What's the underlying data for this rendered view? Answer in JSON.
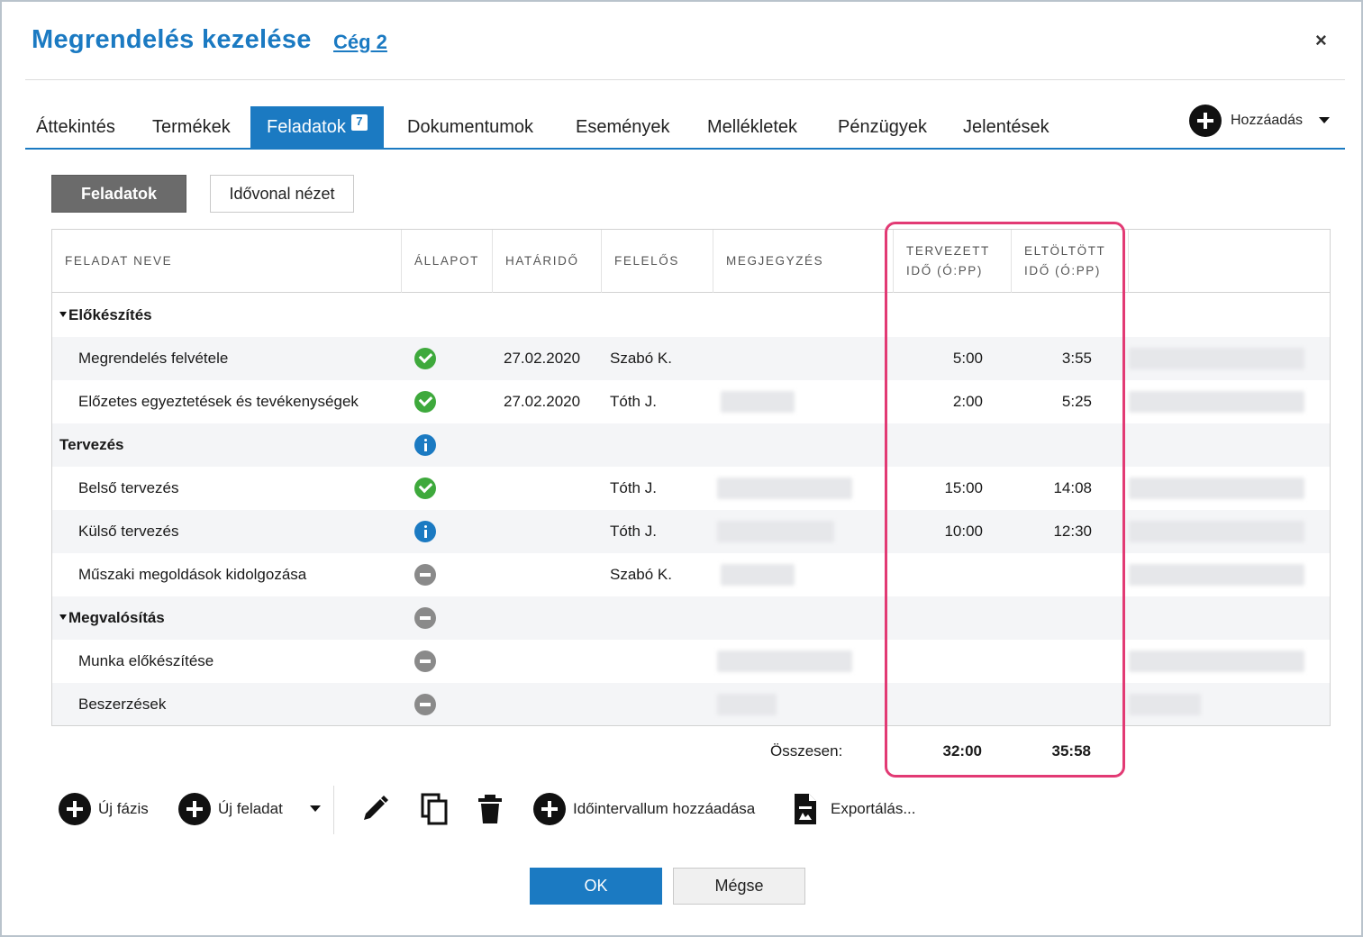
{
  "dialog": {
    "title": "Megrendelés kezelése",
    "company": "Cég 2",
    "close_label": "×"
  },
  "tabs": [
    {
      "label": "Áttekintés"
    },
    {
      "label": "Termékek"
    },
    {
      "label": "Feladatok",
      "badge": "7",
      "active": true
    },
    {
      "label": "Dokumentumok"
    },
    {
      "label": "Események"
    },
    {
      "label": "Mellékletek"
    },
    {
      "label": "Pénzügyek"
    },
    {
      "label": "Jelentések"
    }
  ],
  "add_menu": {
    "label": "Hozzáadás",
    "icon": "plus-circle-icon"
  },
  "view_toggle": {
    "tasks": "Feladatok",
    "timeline": "Idővonal nézet"
  },
  "table": {
    "headers": {
      "name": "FELADAT NEVE",
      "status": "ÁLLAPOT",
      "deadline": "HATÁRIDŐ",
      "owner": "FELELŐS",
      "note": "MEGJEGYZÉS",
      "planned_1": "TERVEZETT",
      "planned_2": "IDŐ (Ó:PP)",
      "spent_1": "ELTÖLTÖTT",
      "spent_2": "IDŐ (Ó:PP)"
    },
    "rows": [
      {
        "type": "phase",
        "name": "Előkészítés",
        "collapsible": true,
        "status": "",
        "deadline": "",
        "owner": "",
        "planned": "",
        "spent": ""
      },
      {
        "type": "task",
        "name": "Megrendelés felvétele",
        "status": "done",
        "deadline": "27.02.2020",
        "owner": "Szabó K.",
        "planned": "5:00",
        "spent": "3:55"
      },
      {
        "type": "task",
        "name": "Előzetes egyeztetések és tevékenységek",
        "status": "done",
        "deadline": "27.02.2020",
        "owner": "Tóth J.",
        "planned": "2:00",
        "spent": "5:25"
      },
      {
        "type": "phase",
        "name": "Tervezés",
        "collapsible": false,
        "status": "info",
        "deadline": "",
        "owner": "",
        "planned": "",
        "spent": ""
      },
      {
        "type": "task",
        "name": "Belső tervezés",
        "status": "done",
        "deadline": "",
        "owner": "Tóth J.",
        "planned": "15:00",
        "spent": "14:08"
      },
      {
        "type": "task",
        "name": "Külső tervezés",
        "status": "info",
        "deadline": "",
        "owner": "Tóth J.",
        "planned": "10:00",
        "spent": "12:30"
      },
      {
        "type": "task",
        "name": "Műszaki megoldások kidolgozása",
        "status": "none",
        "deadline": "",
        "owner": "Szabó K.",
        "planned": "",
        "spent": ""
      },
      {
        "type": "phase",
        "name": "Megvalósítás",
        "collapsible": true,
        "status": "none",
        "deadline": "",
        "owner": "",
        "planned": "",
        "spent": ""
      },
      {
        "type": "task",
        "name": "Munka előkészítése",
        "status": "none",
        "deadline": "",
        "owner": "",
        "planned": "",
        "spent": ""
      },
      {
        "type": "task",
        "name": "Beszerzések",
        "status": "none",
        "deadline": "",
        "owner": "",
        "planned": "",
        "spent": ""
      }
    ],
    "totals": {
      "label": "Összesen:",
      "planned": "32:00",
      "spent": "35:58"
    }
  },
  "toolbar": {
    "new_phase": "Új fázis",
    "new_task": "Új feladat",
    "add_interval": "Időintervallum hozzáadása",
    "export": "Exportálás..."
  },
  "footer": {
    "ok": "OK",
    "cancel": "Mégse"
  },
  "colors": {
    "accent": "#1b7ac2",
    "highlight": "#e23a74",
    "done": "#3ea93c",
    "inactive": "#8a8a8a"
  }
}
